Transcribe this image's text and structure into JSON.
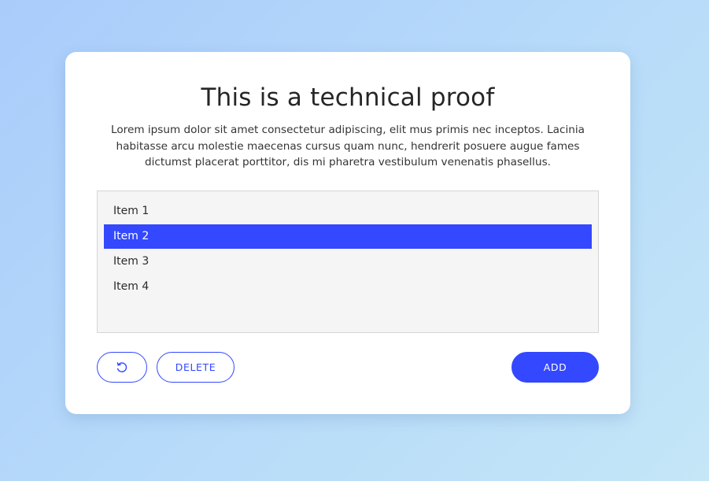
{
  "card": {
    "title": "This is a technical proof",
    "description": "Lorem ipsum dolor sit amet consectetur adipiscing, elit mus primis nec inceptos. Lacinia habitasse arcu molestie maecenas cursus quam nunc, hendrerit posuere augue fames dictumst placerat porttitor, dis mi pharetra vestibulum venenatis phasellus."
  },
  "list": {
    "items": [
      {
        "label": "Item 1",
        "selected": false
      },
      {
        "label": "Item 2",
        "selected": true
      },
      {
        "label": "Item 3",
        "selected": false
      },
      {
        "label": "Item 4",
        "selected": false
      }
    ]
  },
  "actions": {
    "reset_icon": "reset-icon",
    "delete_label": "DELETE",
    "add_label": "ADD"
  },
  "colors": {
    "accent": "#3348ff",
    "card_bg": "#ffffff",
    "list_bg": "#f5f5f5"
  }
}
